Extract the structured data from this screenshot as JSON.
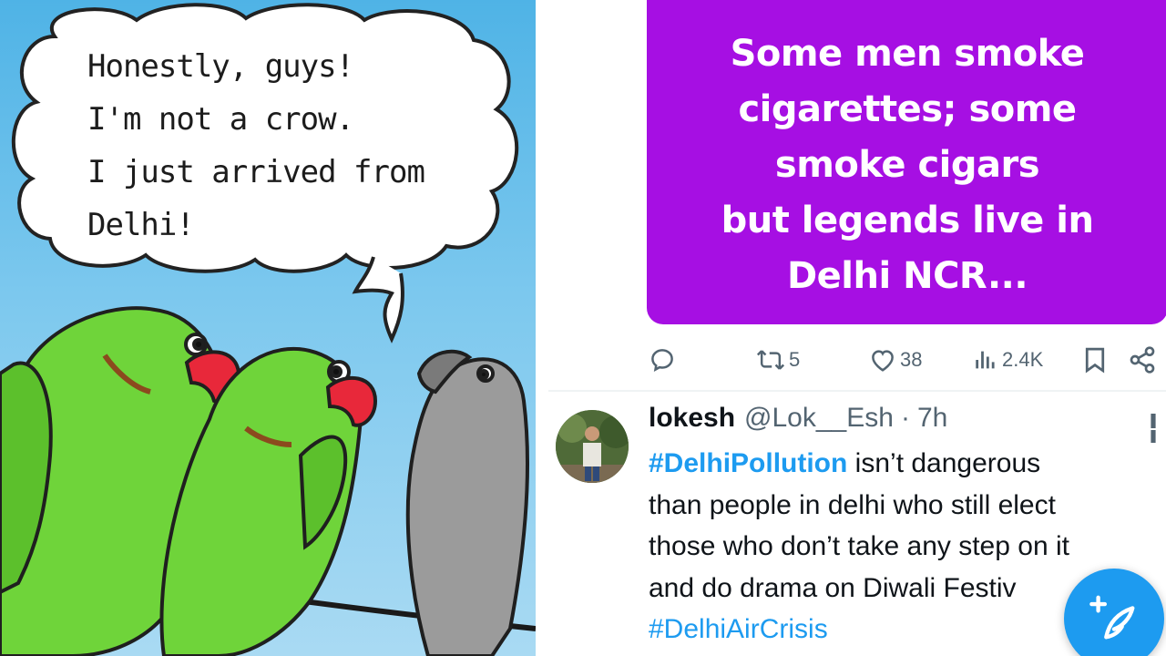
{
  "cartoon": {
    "speech_lines": [
      "Honestly, guys!",
      "I'm not a crow.",
      "I just arrived from",
      "Delhi!"
    ],
    "colors": {
      "sky": "#5ab8e8",
      "parrot": "#6fd43a",
      "beak": "#e8283a",
      "crow": "#9b9b9b"
    }
  },
  "quoted_post": {
    "lines": [
      "Some men smoke",
      "cigarettes; some",
      "smoke cigars",
      "but legends live in",
      "Delhi NCR..."
    ],
    "background": "#a60fe3"
  },
  "post_actions": {
    "reply_icon": "reply-icon",
    "repost_count": "5",
    "like_count": "38",
    "views_count": "2.4K",
    "bookmark_icon": "bookmark-icon",
    "share_icon": "share-icon"
  },
  "reply_tweet": {
    "display_name": "lokesh",
    "handle": "@Lok__Esh",
    "separator": "·",
    "time": "7h",
    "hashtag_1": "#DelhiPollution",
    "line_1_rest": " isn’t dangerous",
    "line_2": "than people in delhi who still elect",
    "line_3": "those who don’t take any step on it",
    "line_4": "and do drama on Diwali Festiv",
    "hashtag_2": "#DelhiAirCrisis"
  },
  "compose_button": {
    "icon": "compose-icon",
    "color": "#1d9bf0"
  }
}
